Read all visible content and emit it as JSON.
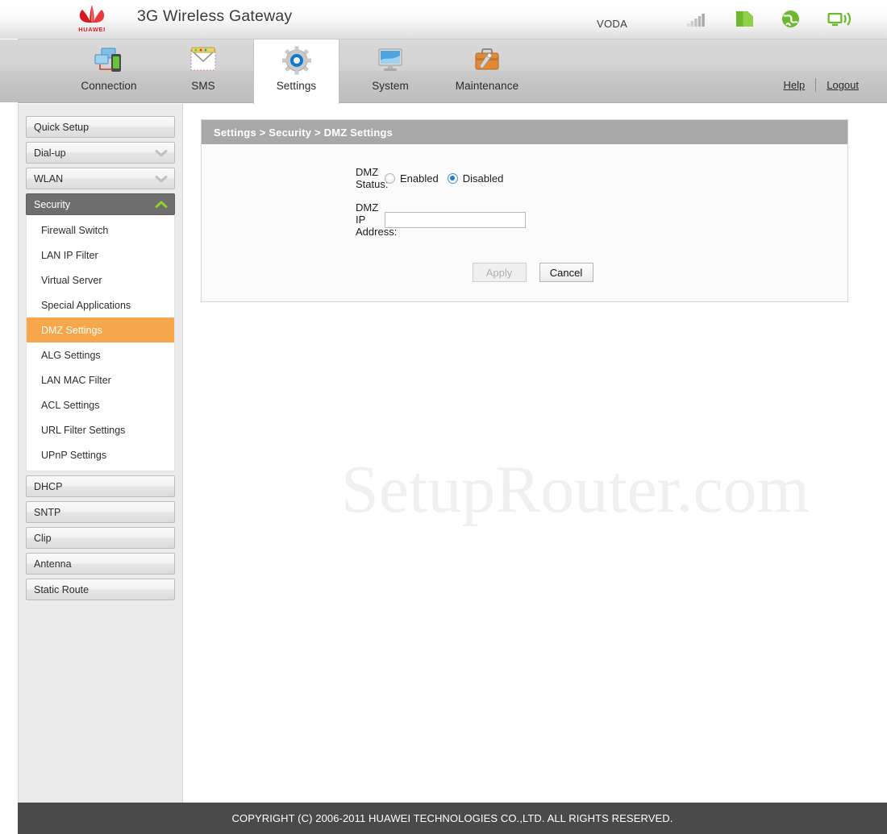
{
  "header": {
    "brand_logo": "huawei-logo",
    "brand_wordmark": "HUAWEI",
    "title": "3G Wireless Gateway",
    "carrier": "VODA",
    "status_icons": [
      {
        "name": "signal-strength-icon",
        "label": "signal-bars"
      },
      {
        "name": "sim-card-icon",
        "label": "sim-card"
      },
      {
        "name": "globe-icon",
        "label": "internet-globe"
      },
      {
        "name": "wifi-broadcast-icon",
        "label": "wifi-broadcast"
      }
    ]
  },
  "tabs": [
    {
      "label": "Connection",
      "icon": "connection-icon",
      "active": false
    },
    {
      "label": "SMS",
      "icon": "sms-envelope-icon",
      "active": false
    },
    {
      "label": "Settings",
      "icon": "gear-icon",
      "active": true
    },
    {
      "label": "System",
      "icon": "monitor-icon",
      "active": false
    },
    {
      "label": "Maintenance",
      "icon": "toolbox-icon",
      "active": false
    }
  ],
  "header_links": {
    "help": "Help",
    "logout": "Logout"
  },
  "sidebar": {
    "groups": [
      {
        "label": "Quick Setup",
        "type": "plain",
        "expanded": false
      },
      {
        "label": "Dial-up",
        "type": "collapsible",
        "expanded": false,
        "chevron": "chevron-down-icon"
      },
      {
        "label": "WLAN",
        "type": "collapsible",
        "expanded": false,
        "chevron": "chevron-down-icon"
      },
      {
        "label": "Security",
        "type": "collapsible",
        "expanded": true,
        "chevron": "chevron-up-icon",
        "items": [
          {
            "label": "Firewall Switch",
            "selected": false
          },
          {
            "label": "LAN IP Filter",
            "selected": false
          },
          {
            "label": "Virtual Server",
            "selected": false
          },
          {
            "label": "Special Applications",
            "selected": false
          },
          {
            "label": "DMZ Settings",
            "selected": true
          },
          {
            "label": "ALG Settings",
            "selected": false
          },
          {
            "label": "LAN MAC Filter",
            "selected": false
          },
          {
            "label": "ACL Settings",
            "selected": false
          },
          {
            "label": "URL Filter Settings",
            "selected": false
          },
          {
            "label": "UPnP Settings",
            "selected": false
          }
        ]
      },
      {
        "label": "DHCP",
        "type": "plain",
        "expanded": false
      },
      {
        "label": "SNTP",
        "type": "plain",
        "expanded": false
      },
      {
        "label": "Clip",
        "type": "plain",
        "expanded": false
      },
      {
        "label": "Antenna",
        "type": "plain",
        "expanded": false
      },
      {
        "label": "Static Route",
        "type": "plain",
        "expanded": false
      }
    ]
  },
  "main": {
    "breadcrumb": "Settings > Security > DMZ Settings",
    "fields": {
      "dmz_status_label": "DMZ Status:",
      "dmz_status_options": [
        "Enabled",
        "Disabled"
      ],
      "dmz_status_value": "Disabled",
      "dmz_ip_label": "DMZ IP Address:",
      "dmz_ip_value": "",
      "dmz_ip_placeholder": ""
    },
    "buttons": {
      "apply": "Apply",
      "apply_disabled": true,
      "cancel": "Cancel"
    }
  },
  "watermark": "SetupRouter.com",
  "footer": {
    "copyright": "COPYRIGHT (C) 2006-2011 HUAWEI TECHNOLOGIES CO.,LTD. ALL RIGHTS RESERVED."
  },
  "colors": {
    "accent_selected": "#f7a74a",
    "panel_header": "#a8a8a8",
    "expanded_group": "#6e6e6e",
    "footer_bg": "#4a4a4a",
    "brand_red": "#e01b21",
    "status_green": "#55b133",
    "radio_blue": "#1a7fd4"
  }
}
